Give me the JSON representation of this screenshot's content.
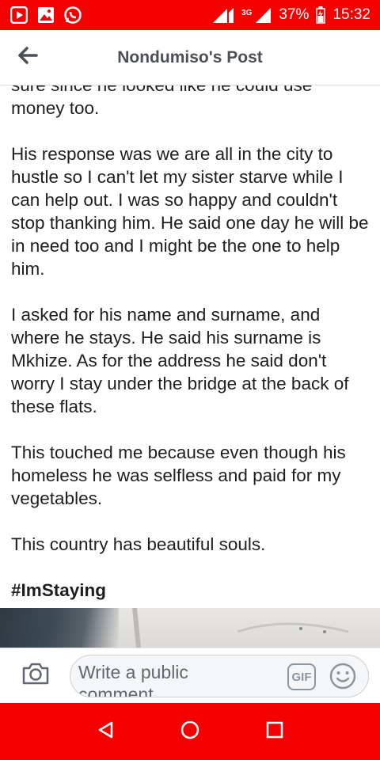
{
  "status_bar": {
    "network": "3G",
    "battery": "37%",
    "time": "15:32",
    "icons": [
      "play-store-icon",
      "gallery-icon",
      "whatsapp-icon",
      "signal-icon",
      "battery-icon"
    ]
  },
  "header": {
    "title": "Nondumiso's Post",
    "back_icon": "back-arrow-icon"
  },
  "post": {
    "paragraphs": [
      "sure since he looked like he could use money too.",
      "His response was we are all in the city to hustle so I can't let my sister starve while I can help out. I was so happy and couldn't stop thanking him. He said one day he will be in need too and I might be the one to help him.",
      "I asked for his name and surname, and where he stays. He said his surname is Mkhize. As for the address he said don't worry I stay under the bridge at the back of these flats.",
      "This touched me because even though his homeless he was selfless and paid for my vegetables.",
      "This country has beautiful souls."
    ],
    "hashtag": "#ImStaying"
  },
  "comment_bar": {
    "placeholder": "Write a public comment",
    "gif_label": "GIF",
    "camera_icon": "camera-icon",
    "emoji_icon": "emoji-icon"
  },
  "nav_bar": {
    "icons": [
      "back-triangle-icon",
      "home-circle-icon",
      "recents-square-icon"
    ]
  },
  "colors": {
    "status_bar": "#f40000",
    "nav_bar": "#f40000",
    "text": "#1c1e21",
    "header_title": "#4b4f56"
  }
}
